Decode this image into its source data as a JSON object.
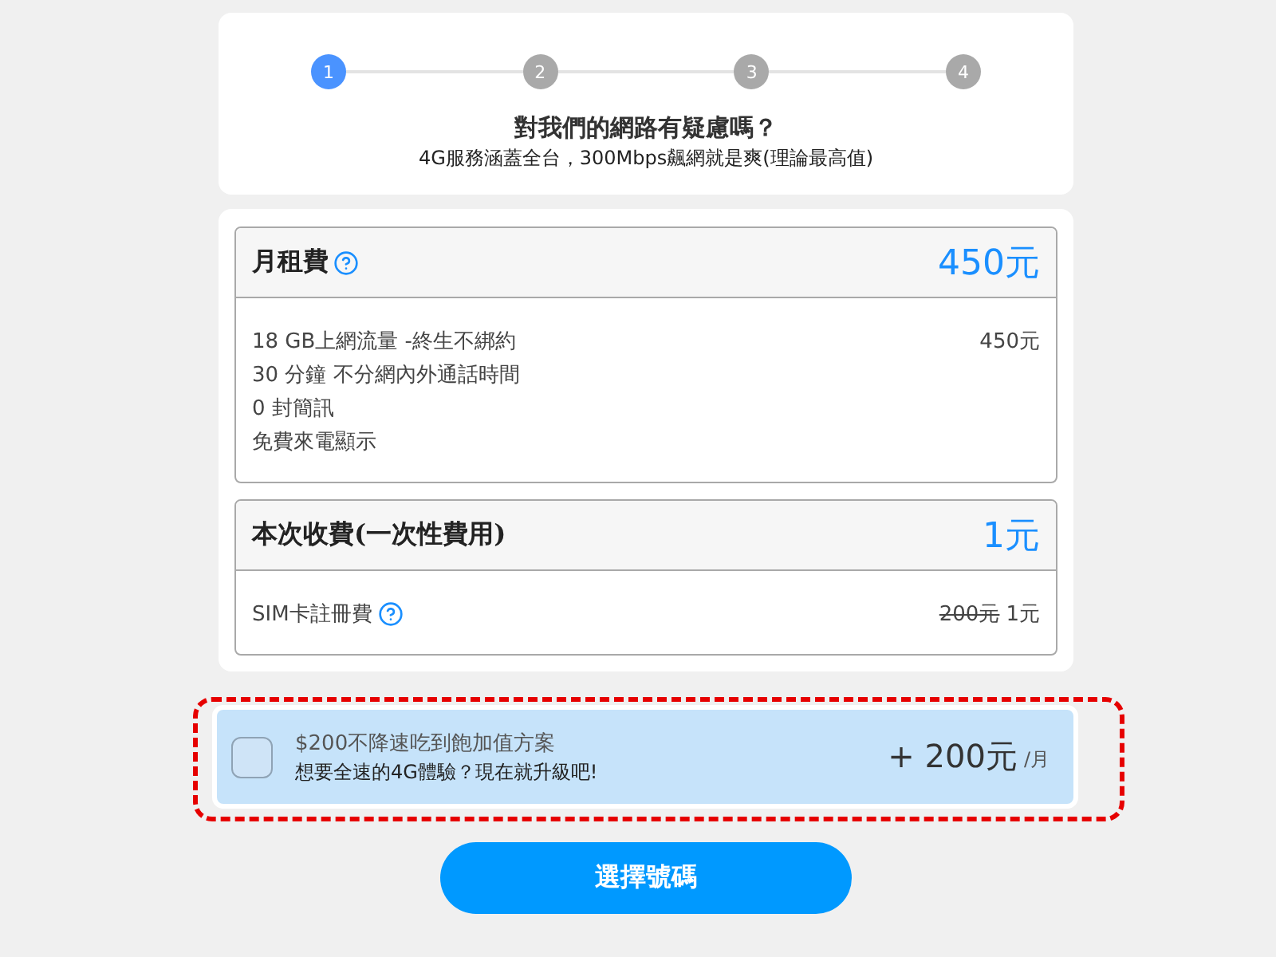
{
  "steps": [
    {
      "label": "1",
      "selected": true
    },
    {
      "label": "2",
      "selected": false
    },
    {
      "label": "3",
      "selected": false
    },
    {
      "label": "4",
      "selected": false
    }
  ],
  "intro": {
    "title": "對我們的網路有疑慮嗎？",
    "subtitle": "4G服務涵蓋全台，300Mbps飆網就是爽(理論最高值)"
  },
  "fees": [
    {
      "title": "月租費",
      "help": true,
      "total": "450元",
      "items": [
        {
          "label": "18 GB上網流量 -終生不綁約",
          "price": "450元"
        },
        {
          "label": "30 分鐘 不分網內外通話時間"
        },
        {
          "label": "0 封簡訊"
        },
        {
          "label": "免費來電顯示"
        }
      ]
    },
    {
      "title": "本次收費(一次性費用)",
      "total": "1元",
      "items": [
        {
          "label": "SIM卡註冊費",
          "help": true,
          "original_price": "200元",
          "price": "1元"
        }
      ]
    }
  ],
  "addon": {
    "checked": false,
    "highlighted": true,
    "title": "$200不降速吃到飽加值方案",
    "description": "想要全速的4G體驗？現在就升級吧!",
    "price": "+ 200元",
    "unit": "/月"
  },
  "button": {
    "label": "選擇號碼"
  }
}
